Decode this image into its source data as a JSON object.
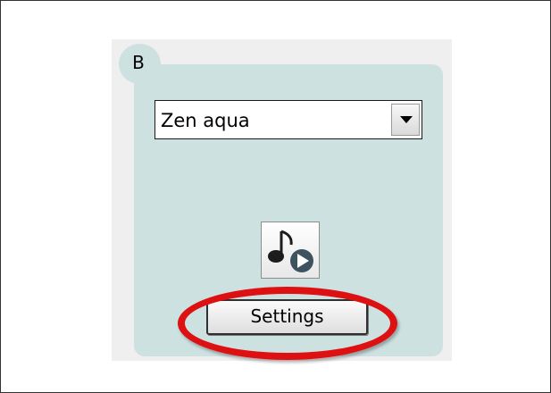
{
  "panel": {
    "badge_label": "B",
    "dropdown": {
      "selected_value": "Zen aqua",
      "arrow_icon": "chevron-down-icon"
    },
    "play_sound_button": {
      "icons": [
        "music-note-icon",
        "play-icon"
      ]
    },
    "settings_button": {
      "label": "Settings"
    }
  },
  "annotation": {
    "highlight_color": "#dd1111"
  }
}
